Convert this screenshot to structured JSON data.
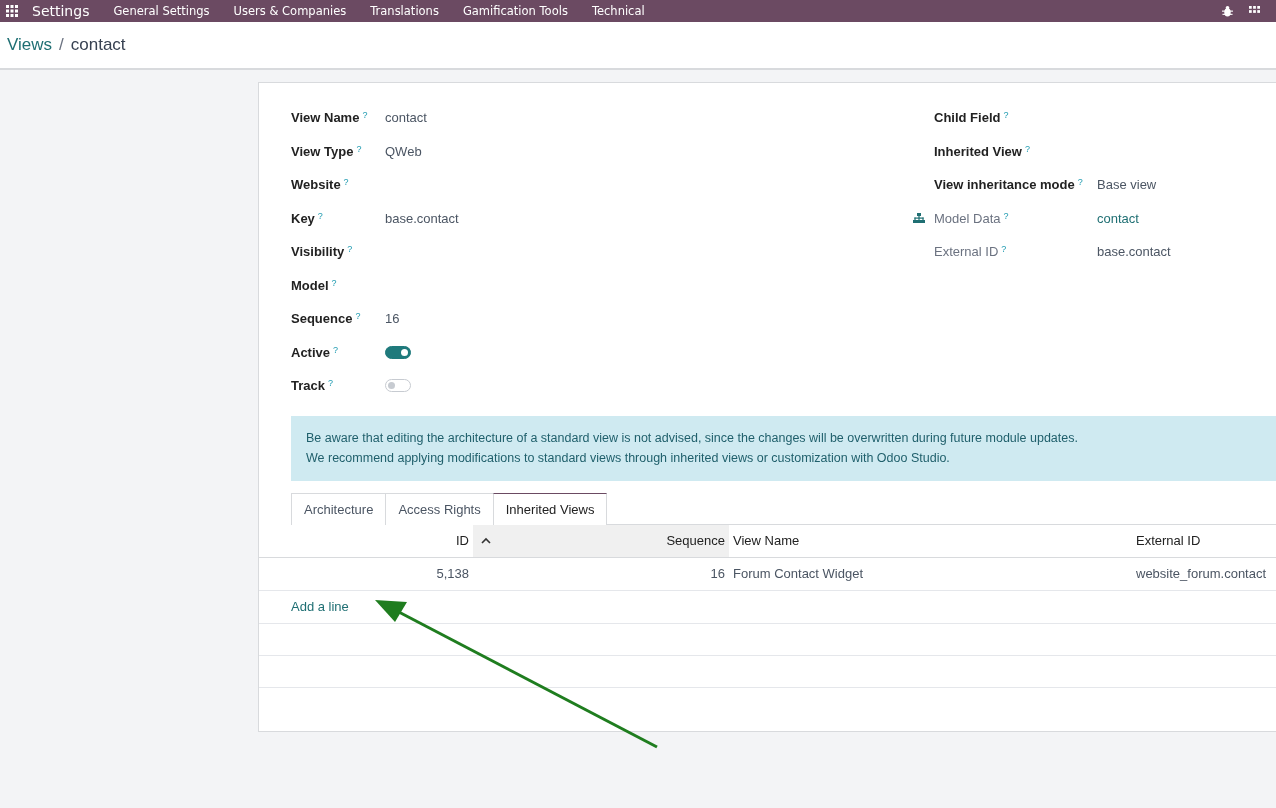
{
  "navbar": {
    "app": "Settings",
    "menu": [
      "General Settings",
      "Users & Companies",
      "Translations",
      "Gamification Tools",
      "Technical"
    ]
  },
  "breadcrumb": [
    {
      "label": "Views",
      "link": true
    },
    {
      "separator": "/",
      "label": "contact",
      "link": false
    }
  ],
  "form": {
    "left": [
      {
        "label": "View Name",
        "help": "?",
        "kind": "text",
        "value": "contact"
      },
      {
        "label": "View Type",
        "help": "?",
        "kind": "text",
        "value": "QWeb"
      },
      {
        "label": "Website",
        "help": "?",
        "kind": "text"
      },
      {
        "label": "Key",
        "help": "?",
        "kind": "text",
        "value": "base.contact",
        "action": true
      },
      {
        "label": "Visibility",
        "help": "?",
        "kind": "text"
      },
      {
        "label": "Model",
        "help": "?",
        "kind": "text"
      },
      {
        "label": "Sequence",
        "help": "?",
        "kind": "text",
        "value": "16"
      },
      {
        "label": "Active",
        "help": "?",
        "kind": "toggle",
        "on": true
      },
      {
        "label": "Track",
        "help": "?",
        "kind": "toggle",
        "on": false
      }
    ],
    "right": [
      {
        "label": "Child Field",
        "help": "?",
        "kind": "text",
        "readonly": false
      },
      {
        "label": "Inherited View",
        "help": "?",
        "kind": "text",
        "readonly": false
      },
      {
        "label": "View inheritance mode",
        "help": "?",
        "kind": "text",
        "value": "Base view",
        "readonly": false
      },
      {
        "label": "Model Data",
        "help": "?",
        "kind": "link",
        "value": "contact",
        "readonly": true
      },
      {
        "label": "External ID",
        "help": "?",
        "kind": "text",
        "value": "base.contact",
        "readonly": true
      }
    ]
  },
  "alert": [
    "Be aware that editing the architecture of a standard view is not advised, since the changes will be overwritten during future module updates.",
    "We recommend applying modifications to standard views through inherited views or customization with Odoo Studio."
  ],
  "tabs": [
    {
      "label": "Architecture",
      "selected": false
    },
    {
      "label": "Access Rights",
      "selected": false
    },
    {
      "label": "Inherited Views",
      "selected": true
    }
  ],
  "table": {
    "columns": [
      {
        "label": "ID",
        "sorted": false
      },
      {
        "label": "Sequence",
        "sorted": true
      },
      {
        "label": "View Name",
        "sorted": false
      },
      {
        "label": "External ID",
        "sorted": false
      }
    ],
    "rows": [
      [
        "5,138",
        "16",
        "Forum Contact Widget",
        "website_forum.contact"
      ]
    ],
    "add_line": "Add a line"
  }
}
